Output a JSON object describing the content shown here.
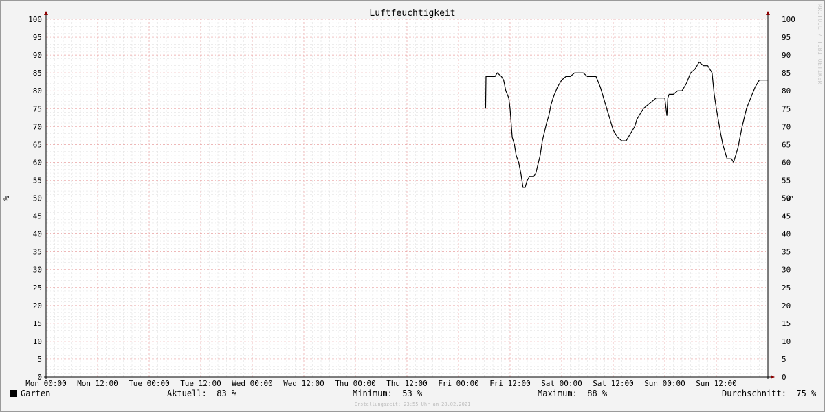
{
  "chart_data": {
    "type": "line",
    "title": "Luftfeuchtigkeit",
    "ylabel": "%",
    "ylim": [
      0,
      100
    ],
    "ytick_step": 5,
    "x_ticks": [
      "Mon 00:00",
      "Mon 12:00",
      "Tue 00:00",
      "Tue 12:00",
      "Wed 00:00",
      "Wed 12:00",
      "Thu 00:00",
      "Thu 12:00",
      "Fri 00:00",
      "Fri 12:00",
      "Sat 00:00",
      "Sat 12:00",
      "Sun 00:00",
      "Sun 12:00"
    ],
    "x_unit": "hours since Mon 00:00",
    "xlim": [
      0,
      168
    ],
    "grid": true,
    "series": [
      {
        "name": "Garten",
        "color": "#000000",
        "x": [
          102.3,
          102.4,
          103.5,
          104.5,
          105.0,
          106.0,
          106.5,
          107.0,
          107.7,
          108.0,
          108.5,
          109.0,
          109.4,
          110.0,
          110.5,
          111.0,
          111.5,
          112.0,
          112.5,
          113.0,
          113.5,
          114.0,
          115.0,
          115.5,
          116.5,
          117.0,
          117.5,
          118.0,
          119.0,
          120.0,
          121.0,
          122.0,
          123.0,
          124.0,
          125.0,
          126.0,
          127.0,
          128.0,
          129.0,
          130.0,
          131.0,
          132.0,
          133.0,
          134.0,
          135.0,
          136.0,
          137.0,
          137.5,
          138.0,
          138.5,
          139.0,
          140.0,
          141.0,
          142.0,
          143.0,
          144.0,
          144.5,
          144.7,
          145.0,
          146.0,
          147.0,
          148.0,
          149.0,
          150.0,
          151.0,
          151.5,
          152.0,
          153.0,
          154.0,
          155.0,
          155.5,
          156.0,
          157.0,
          157.5,
          158.0,
          158.5,
          159.0,
          159.5,
          160.0,
          161.0,
          162.0,
          163.0,
          164.0,
          165.0,
          166.0,
          167.0,
          168.0
        ],
        "values": [
          75,
          84,
          84,
          84,
          85,
          84,
          83,
          80,
          78,
          75,
          67,
          65,
          62,
          60,
          57,
          53,
          53,
          55,
          56,
          56,
          56,
          57,
          62,
          66,
          71,
          73,
          76,
          78,
          81,
          83,
          84,
          84,
          85,
          85,
          85,
          84,
          84,
          84,
          81,
          77,
          73,
          69,
          67,
          66,
          66,
          68,
          70,
          72,
          73,
          74,
          75,
          76,
          77,
          78,
          78,
          78,
          73,
          78,
          79,
          79,
          80,
          80,
          82,
          85,
          86,
          87,
          88,
          87,
          87,
          85,
          79,
          75,
          68,
          65,
          63,
          61,
          61,
          61,
          60,
          64,
          70,
          75,
          78,
          81,
          83,
          83,
          83
        ]
      }
    ]
  },
  "legend": {
    "series_name": "Garten",
    "current_label": "Aktuell:",
    "current_value": "83 %",
    "min_label": "Minimum:",
    "min_value": "53 %",
    "max_label": "Maximum:",
    "max_value": "88 %",
    "avg_label": "Durchschnitt:",
    "avg_value": "75 %"
  },
  "watermark": "RRDTOOL / TOBI OETIKER",
  "footer": "Erstellungszeit: 23:55 Uhr am 28.02.2021"
}
